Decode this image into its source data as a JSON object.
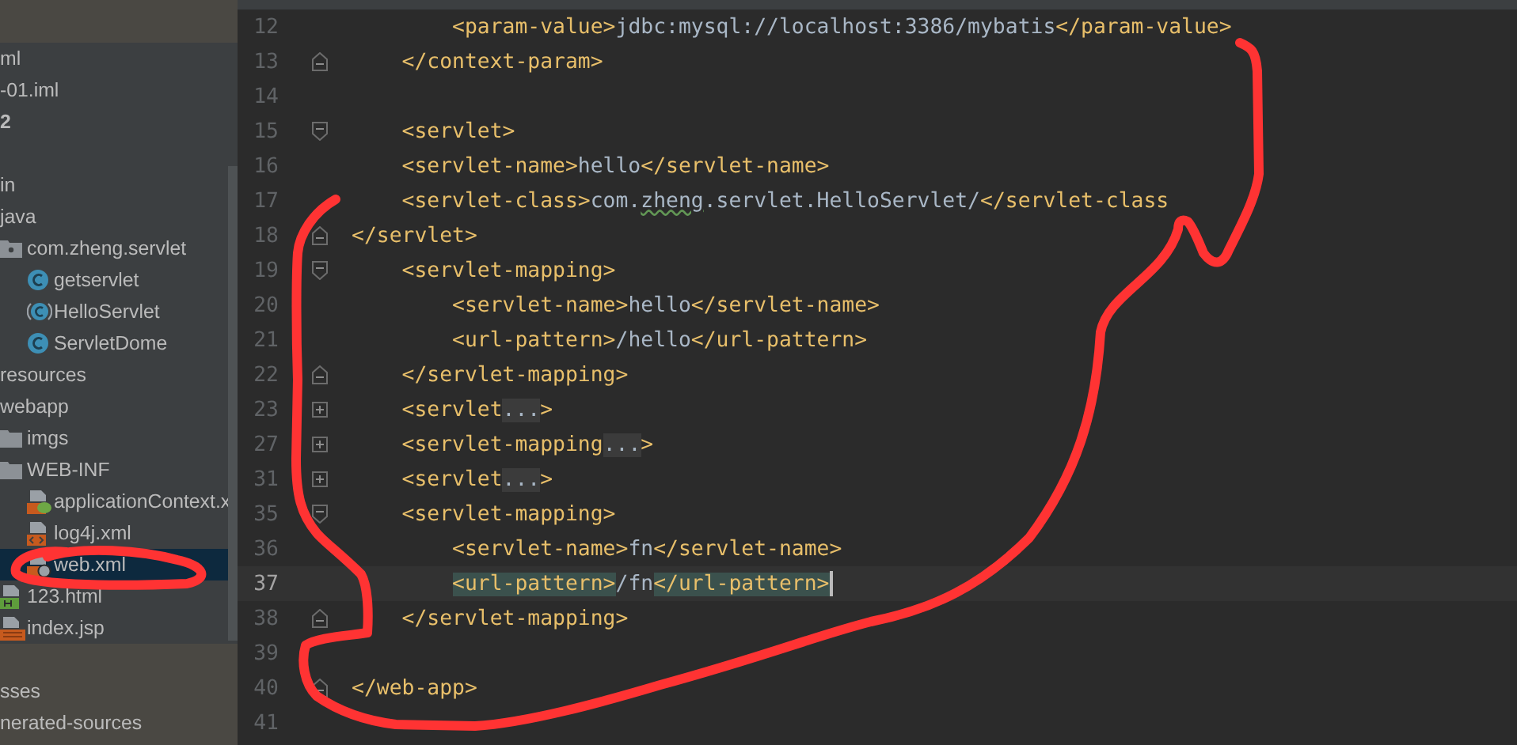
{
  "sidebar": {
    "header_items": [
      {
        "text": "ml",
        "bold": false
      },
      {
        "text": "-01.iml",
        "bold": false
      },
      {
        "text": "2",
        "bold": true
      }
    ],
    "tree": [
      {
        "text": "in",
        "selected": false
      },
      {
        "text": "java",
        "selected": false,
        "children": [
          {
            "text": "com.zheng.servlet",
            "kind": "package",
            "selected": false,
            "children": [
              {
                "text": "getservlet",
                "kind": "class",
                "selected": false
              },
              {
                "text": "HelloServlet",
                "kind": "main-class",
                "selected": false
              },
              {
                "text": "ServletDome",
                "kind": "class",
                "selected": false
              }
            ]
          }
        ]
      },
      {
        "text": "resources",
        "selected": false
      },
      {
        "text": "webapp",
        "selected": false,
        "children": [
          {
            "text": "imgs",
            "kind": "folder",
            "selected": false
          },
          {
            "text": "WEB-INF",
            "kind": "folder",
            "selected": false,
            "children": [
              {
                "text": "applicationContext.x",
                "kind": "spring",
                "selected": false
              },
              {
                "text": "log4j.xml",
                "kind": "xml",
                "selected": false
              },
              {
                "text": "web.xml",
                "kind": "web",
                "selected": true
              }
            ]
          },
          {
            "text": "123.html",
            "kind": "html",
            "selected": false
          },
          {
            "text": "index.jsp",
            "kind": "jsp",
            "selected": false
          }
        ]
      }
    ],
    "bottom_items": [
      {
        "text": "sses"
      },
      {
        "text": "nerated-sources"
      }
    ]
  },
  "editor": {
    "lines": [
      {
        "number": "12",
        "kind": "plain",
        "current": false,
        "parts": [
          {
            "kind": "tag",
            "text": "        <param-value>"
          },
          {
            "kind": "text",
            "text": "jdbc:mysql://localhost:3386/mybatis"
          },
          {
            "kind": "tag",
            "text": "</param-value>"
          }
        ]
      },
      {
        "number": "13",
        "kind": "fold-end",
        "current": false,
        "parts": [
          {
            "kind": "tag",
            "text": "    </context-param>"
          }
        ]
      },
      {
        "number": "14",
        "kind": "plain",
        "current": false
      },
      {
        "number": "15",
        "kind": "fold-start",
        "current": false,
        "parts": [
          {
            "kind": "tag",
            "text": "    <servlet>"
          }
        ]
      },
      {
        "number": "16",
        "kind": "plain",
        "current": false,
        "parts": [
          {
            "kind": "tag",
            "text": "    <servlet-name>"
          },
          {
            "kind": "text",
            "text": "hello"
          },
          {
            "kind": "tag",
            "text": "</servlet-name>"
          }
        ]
      },
      {
        "number": "17",
        "kind": "plain",
        "current": false,
        "parts": [
          {
            "kind": "tag",
            "text": "    <servlet-class>"
          },
          {
            "kind": "text",
            "text": "com."
          },
          {
            "kind": "typo",
            "text": "zheng"
          },
          {
            "kind": "text",
            "text": ".servlet.HelloServlet/"
          },
          {
            "kind": "tag",
            "text": "</servlet-class"
          }
        ]
      },
      {
        "number": "18",
        "kind": "fold-end",
        "current": false,
        "parts": [
          {
            "kind": "tag",
            "text": "</servlet>"
          }
        ]
      },
      {
        "number": "19",
        "kind": "fold-start",
        "current": false,
        "parts": [
          {
            "kind": "tag",
            "text": "    <servlet-mapping>"
          }
        ]
      },
      {
        "number": "20",
        "kind": "plain",
        "current": false,
        "parts": [
          {
            "kind": "tag",
            "text": "        <servlet-name>"
          },
          {
            "kind": "text",
            "text": "hello"
          },
          {
            "kind": "tag",
            "text": "</servlet-name>"
          }
        ]
      },
      {
        "number": "21",
        "kind": "plain",
        "current": false,
        "parts": [
          {
            "kind": "tag",
            "text": "        <url-pattern>"
          },
          {
            "kind": "text",
            "text": "/hello"
          },
          {
            "kind": "tag",
            "text": "</url-pattern>"
          }
        ]
      },
      {
        "number": "22",
        "kind": "fold-end",
        "current": false,
        "parts": [
          {
            "kind": "tag",
            "text": "    </servlet-mapping>"
          }
        ]
      },
      {
        "number": "23",
        "kind": "folded",
        "current": false,
        "parts": [
          {
            "kind": "tag",
            "text": "    <servlet"
          },
          {
            "kind": "folded",
            "text": "..."
          },
          {
            "kind": "tag",
            "text": ">"
          }
        ]
      },
      {
        "number": "27",
        "kind": "folded",
        "current": false,
        "parts": [
          {
            "kind": "tag",
            "text": "    <servlet-mapping"
          },
          {
            "kind": "folded",
            "text": "..."
          },
          {
            "kind": "tag",
            "text": ">"
          }
        ]
      },
      {
        "number": "31",
        "kind": "folded",
        "current": false,
        "parts": [
          {
            "kind": "tag",
            "text": "    <servlet"
          },
          {
            "kind": "folded",
            "text": "..."
          },
          {
            "kind": "tag",
            "text": ">"
          }
        ]
      },
      {
        "number": "35",
        "kind": "fold-start",
        "current": false,
        "parts": [
          {
            "kind": "tag",
            "text": "    <servlet-mapping>"
          }
        ]
      },
      {
        "number": "36",
        "kind": "plain",
        "current": false,
        "parts": [
          {
            "kind": "tag",
            "text": "        <servlet-name>"
          },
          {
            "kind": "text",
            "text": "fn"
          },
          {
            "kind": "tag",
            "text": "</servlet-name>"
          }
        ]
      },
      {
        "number": "37",
        "kind": "plain",
        "current": true,
        "parts": [
          {
            "kind": "match",
            "text": "        <url-pattern>"
          },
          {
            "kind": "text",
            "text": "/fn"
          },
          {
            "kind": "match",
            "text": "</url-pattern>"
          }
        ]
      },
      {
        "number": "38",
        "kind": "fold-end",
        "current": false,
        "parts": [
          {
            "kind": "tag",
            "text": "    </servlet-mapping>"
          }
        ]
      },
      {
        "number": "39",
        "kind": "plain",
        "current": false
      },
      {
        "number": "40",
        "kind": "fold-end",
        "current": false,
        "parts": [
          {
            "kind": "tag",
            "text": "</web-app>"
          }
        ]
      },
      {
        "number": "41",
        "kind": "plain",
        "current": false
      }
    ]
  }
}
